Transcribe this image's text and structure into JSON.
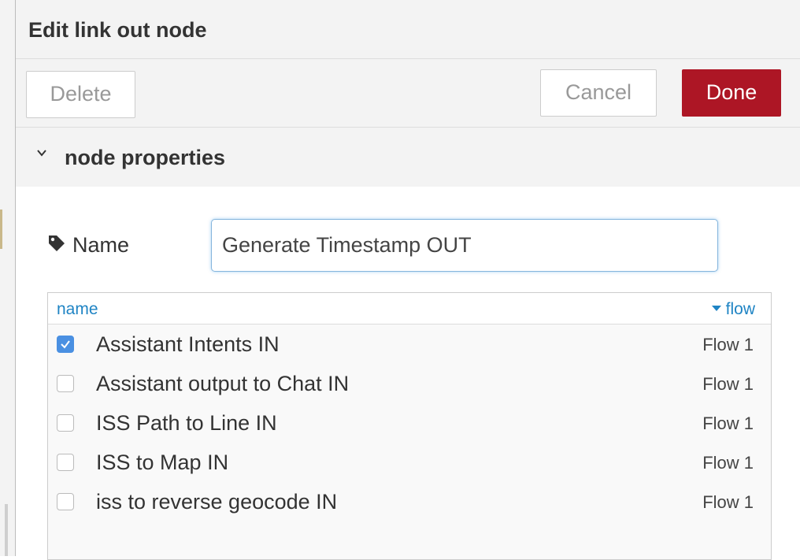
{
  "dialog": {
    "title": "Edit link out node",
    "buttons": {
      "delete": "Delete",
      "cancel": "Cancel",
      "done": "Done"
    },
    "section": {
      "title": "node properties",
      "icon": "chevron-down-icon"
    }
  },
  "form": {
    "name_label": "Name",
    "name_icon": "tag-icon",
    "name_value": "Generate Timestamp OUT"
  },
  "link_list": {
    "columns": {
      "name": "name",
      "flow": "flow"
    },
    "sort_indicator": "caret-down-icon",
    "rows": [
      {
        "name": "Assistant Intents IN",
        "flow": "Flow 1",
        "checked": true
      },
      {
        "name": "Assistant output to Chat IN",
        "flow": "Flow 1",
        "checked": false
      },
      {
        "name": "ISS Path to Line IN",
        "flow": "Flow 1",
        "checked": false
      },
      {
        "name": "ISS to Map IN",
        "flow": "Flow 1",
        "checked": false
      },
      {
        "name": "iss to reverse geocode IN",
        "flow": "Flow 1",
        "checked": false
      }
    ]
  },
  "colors": {
    "done_button": "#ad1625",
    "link_blue": "#1f84c4",
    "checkbox_checked": "#4a90e2",
    "panel_bg": "#f3f3f3"
  }
}
